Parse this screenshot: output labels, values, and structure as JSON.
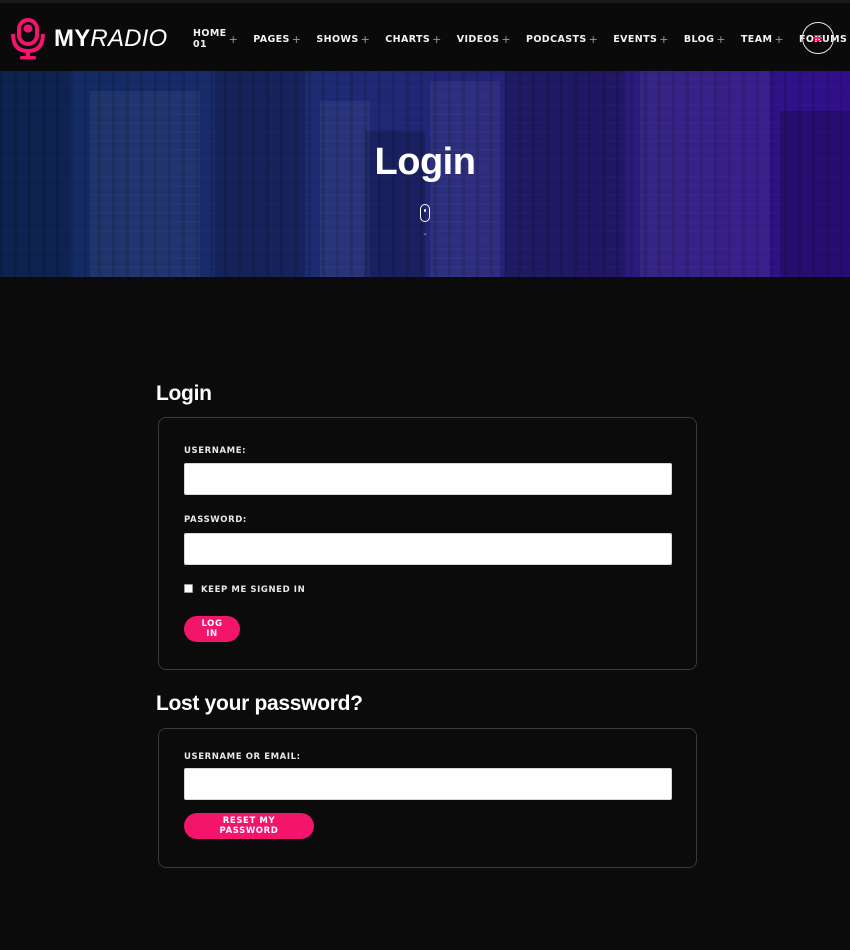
{
  "brand": {
    "name_bold": "MY",
    "name_light": "RADIO",
    "accent_color": "#f3146c"
  },
  "nav": {
    "items": [
      {
        "label": "HOME 01",
        "icon": "plus-icon"
      },
      {
        "label": "PAGES",
        "icon": "plus-icon"
      },
      {
        "label": "SHOWS",
        "icon": "plus-icon"
      },
      {
        "label": "CHARTS",
        "icon": "plus-icon"
      },
      {
        "label": "VIDEOS",
        "icon": "plus-icon"
      },
      {
        "label": "PODCASTS",
        "icon": "plus-icon"
      },
      {
        "label": "EVENTS",
        "icon": "plus-icon"
      },
      {
        "label": "BLOG",
        "icon": "plus-icon"
      },
      {
        "label": "TEAM",
        "icon": "plus-icon"
      },
      {
        "label": "FORUMS",
        "icon": "plus-icon"
      }
    ],
    "plus_glyph": "+",
    "menu_icon": "hamburger-menu-icon"
  },
  "hero": {
    "title": "Login",
    "scroll_icon": "mouse-scroll-icon"
  },
  "login": {
    "heading": "Login",
    "username_label": "USERNAME:",
    "username_value": "",
    "password_label": "PASSWORD:",
    "password_value": "",
    "remember_label": "KEEP ME SIGNED IN",
    "remember_checked": false,
    "submit_label": "LOG IN"
  },
  "lost_password": {
    "heading": "Lost your password?",
    "user_or_email_label": "USERNAME OR EMAIL:",
    "user_or_email_value": "",
    "submit_label": "RESET MY PASSWORD"
  }
}
